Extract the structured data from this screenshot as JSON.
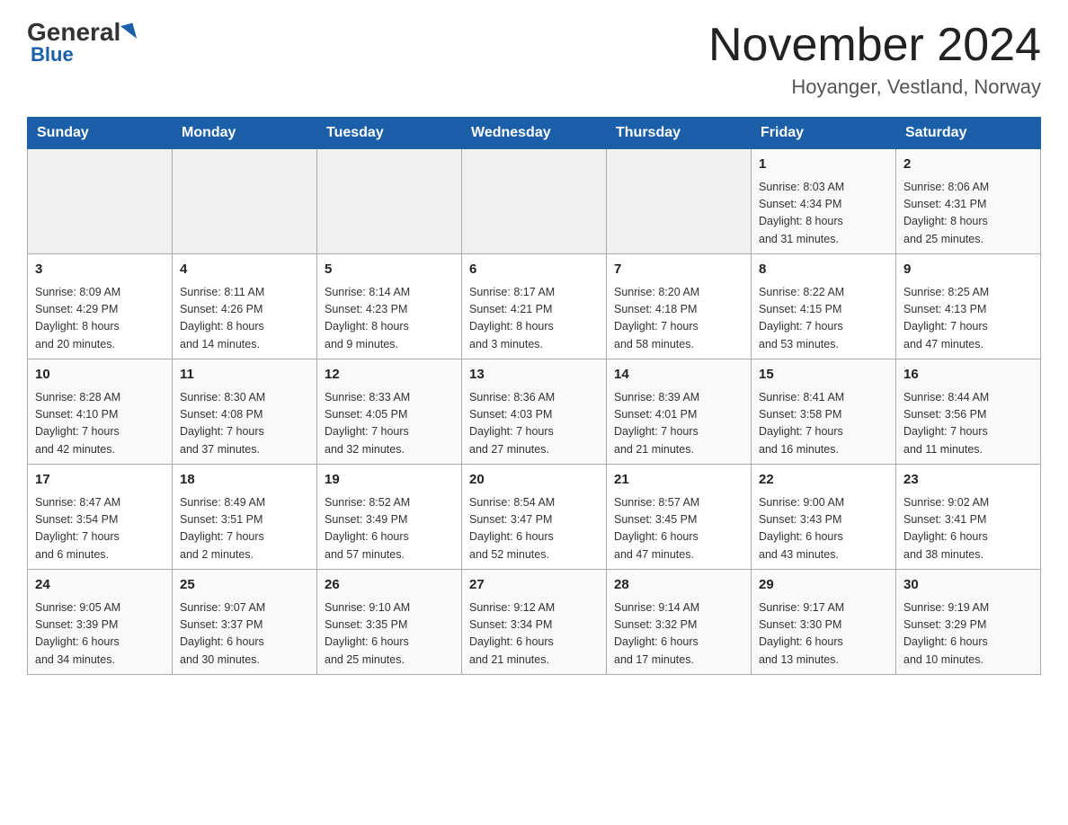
{
  "header": {
    "logo": {
      "part1": "General",
      "part2": "Blue"
    },
    "title": "November 2024",
    "location": "Hoyanger, Vestland, Norway"
  },
  "weekdays": [
    "Sunday",
    "Monday",
    "Tuesday",
    "Wednesday",
    "Thursday",
    "Friday",
    "Saturday"
  ],
  "weeks": [
    [
      {
        "day": "",
        "info": ""
      },
      {
        "day": "",
        "info": ""
      },
      {
        "day": "",
        "info": ""
      },
      {
        "day": "",
        "info": ""
      },
      {
        "day": "",
        "info": ""
      },
      {
        "day": "1",
        "info": "Sunrise: 8:03 AM\nSunset: 4:34 PM\nDaylight: 8 hours\nand 31 minutes."
      },
      {
        "day": "2",
        "info": "Sunrise: 8:06 AM\nSunset: 4:31 PM\nDaylight: 8 hours\nand 25 minutes."
      }
    ],
    [
      {
        "day": "3",
        "info": "Sunrise: 8:09 AM\nSunset: 4:29 PM\nDaylight: 8 hours\nand 20 minutes."
      },
      {
        "day": "4",
        "info": "Sunrise: 8:11 AM\nSunset: 4:26 PM\nDaylight: 8 hours\nand 14 minutes."
      },
      {
        "day": "5",
        "info": "Sunrise: 8:14 AM\nSunset: 4:23 PM\nDaylight: 8 hours\nand 9 minutes."
      },
      {
        "day": "6",
        "info": "Sunrise: 8:17 AM\nSunset: 4:21 PM\nDaylight: 8 hours\nand 3 minutes."
      },
      {
        "day": "7",
        "info": "Sunrise: 8:20 AM\nSunset: 4:18 PM\nDaylight: 7 hours\nand 58 minutes."
      },
      {
        "day": "8",
        "info": "Sunrise: 8:22 AM\nSunset: 4:15 PM\nDaylight: 7 hours\nand 53 minutes."
      },
      {
        "day": "9",
        "info": "Sunrise: 8:25 AM\nSunset: 4:13 PM\nDaylight: 7 hours\nand 47 minutes."
      }
    ],
    [
      {
        "day": "10",
        "info": "Sunrise: 8:28 AM\nSunset: 4:10 PM\nDaylight: 7 hours\nand 42 minutes."
      },
      {
        "day": "11",
        "info": "Sunrise: 8:30 AM\nSunset: 4:08 PM\nDaylight: 7 hours\nand 37 minutes."
      },
      {
        "day": "12",
        "info": "Sunrise: 8:33 AM\nSunset: 4:05 PM\nDaylight: 7 hours\nand 32 minutes."
      },
      {
        "day": "13",
        "info": "Sunrise: 8:36 AM\nSunset: 4:03 PM\nDaylight: 7 hours\nand 27 minutes."
      },
      {
        "day": "14",
        "info": "Sunrise: 8:39 AM\nSunset: 4:01 PM\nDaylight: 7 hours\nand 21 minutes."
      },
      {
        "day": "15",
        "info": "Sunrise: 8:41 AM\nSunset: 3:58 PM\nDaylight: 7 hours\nand 16 minutes."
      },
      {
        "day": "16",
        "info": "Sunrise: 8:44 AM\nSunset: 3:56 PM\nDaylight: 7 hours\nand 11 minutes."
      }
    ],
    [
      {
        "day": "17",
        "info": "Sunrise: 8:47 AM\nSunset: 3:54 PM\nDaylight: 7 hours\nand 6 minutes."
      },
      {
        "day": "18",
        "info": "Sunrise: 8:49 AM\nSunset: 3:51 PM\nDaylight: 7 hours\nand 2 minutes."
      },
      {
        "day": "19",
        "info": "Sunrise: 8:52 AM\nSunset: 3:49 PM\nDaylight: 6 hours\nand 57 minutes."
      },
      {
        "day": "20",
        "info": "Sunrise: 8:54 AM\nSunset: 3:47 PM\nDaylight: 6 hours\nand 52 minutes."
      },
      {
        "day": "21",
        "info": "Sunrise: 8:57 AM\nSunset: 3:45 PM\nDaylight: 6 hours\nand 47 minutes."
      },
      {
        "day": "22",
        "info": "Sunrise: 9:00 AM\nSunset: 3:43 PM\nDaylight: 6 hours\nand 43 minutes."
      },
      {
        "day": "23",
        "info": "Sunrise: 9:02 AM\nSunset: 3:41 PM\nDaylight: 6 hours\nand 38 minutes."
      }
    ],
    [
      {
        "day": "24",
        "info": "Sunrise: 9:05 AM\nSunset: 3:39 PM\nDaylight: 6 hours\nand 34 minutes."
      },
      {
        "day": "25",
        "info": "Sunrise: 9:07 AM\nSunset: 3:37 PM\nDaylight: 6 hours\nand 30 minutes."
      },
      {
        "day": "26",
        "info": "Sunrise: 9:10 AM\nSunset: 3:35 PM\nDaylight: 6 hours\nand 25 minutes."
      },
      {
        "day": "27",
        "info": "Sunrise: 9:12 AM\nSunset: 3:34 PM\nDaylight: 6 hours\nand 21 minutes."
      },
      {
        "day": "28",
        "info": "Sunrise: 9:14 AM\nSunset: 3:32 PM\nDaylight: 6 hours\nand 17 minutes."
      },
      {
        "day": "29",
        "info": "Sunrise: 9:17 AM\nSunset: 3:30 PM\nDaylight: 6 hours\nand 13 minutes."
      },
      {
        "day": "30",
        "info": "Sunrise: 9:19 AM\nSunset: 3:29 PM\nDaylight: 6 hours\nand 10 minutes."
      }
    ]
  ]
}
